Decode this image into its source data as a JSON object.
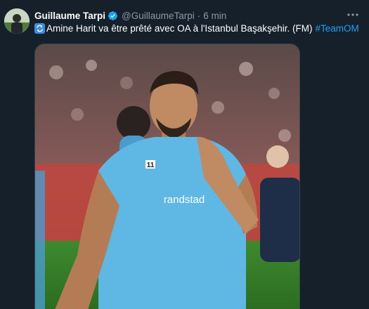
{
  "tweet": {
    "author_name": "Guillaume Tarpi",
    "handle": "@GuillaumeTarpi",
    "separator": "·",
    "time": "6 min",
    "text": "Amine Harit va être prêté avec OA à l'Istanbul Başakşehir. (FM)",
    "hashtag": "#TeamOM",
    "emoji_icon": "repeat-arrows-icon",
    "verified_icon": "verified-badge-icon",
    "more_icon": "more-options-icon"
  },
  "media": {
    "jersey_number": "11",
    "jersey_sponsor": "randstad"
  },
  "colors": {
    "background": "#15202b",
    "link": "#1da1f2",
    "muted": "#8899a6",
    "jersey": "#5fb7e4"
  }
}
